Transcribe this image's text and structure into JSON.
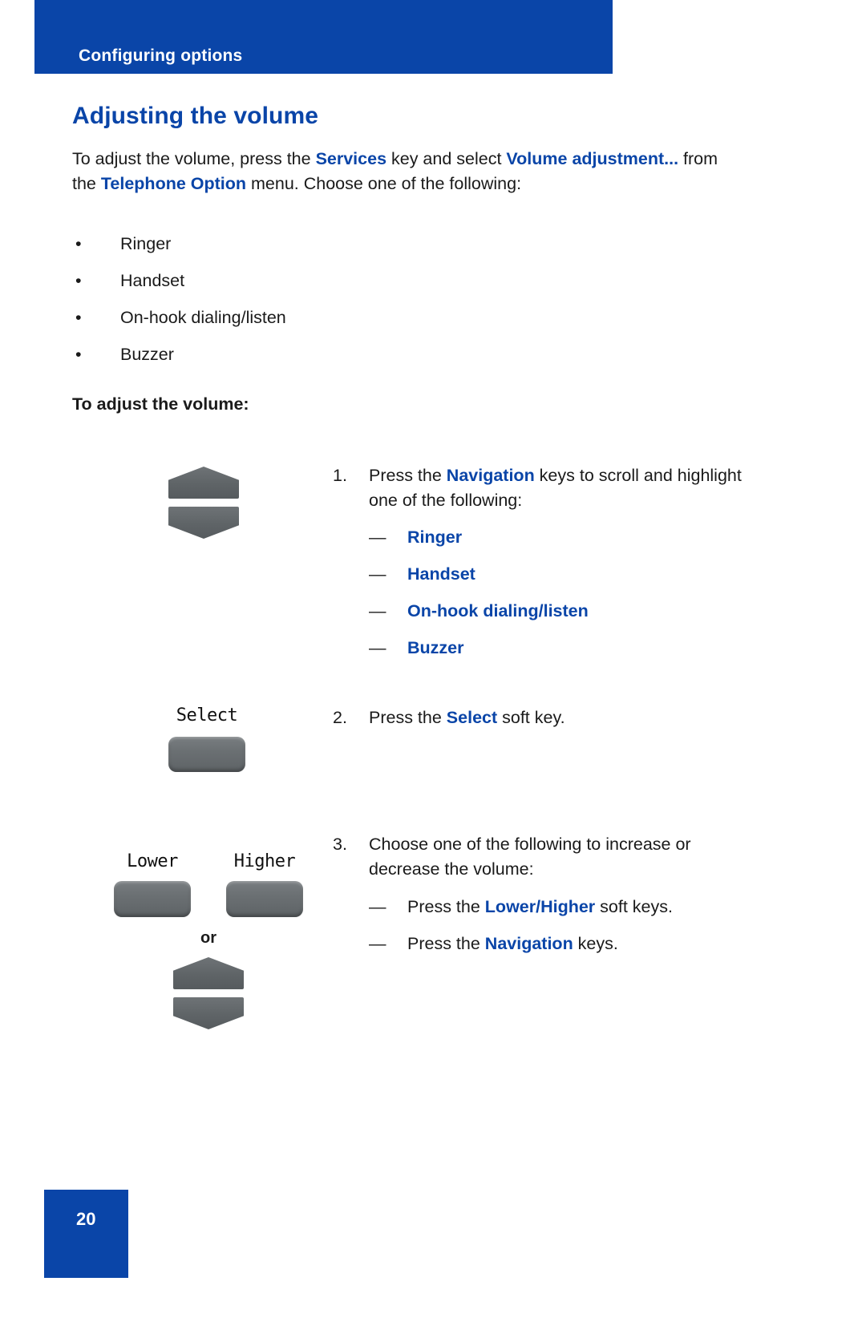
{
  "header": {
    "breadcrumb": "Configuring options"
  },
  "page_title": "Adjusting the volume",
  "intro": {
    "p1": "To adjust the volume, press the ",
    "services": "Services",
    "p2": " key and select ",
    "volume_adjustment": "Volume adjustment...",
    "p3": " from the ",
    "telephone_option": "Telephone Option",
    "p4": " menu. Choose one of the following:"
  },
  "bullet_marker": "•",
  "options": [
    "Ringer",
    "Handset",
    "On-hook dialing/listen",
    "Buzzer"
  ],
  "sub_heading": "To adjust the volume:",
  "dash_marker": "—",
  "steps": [
    {
      "number": "1.",
      "text_before": "Press the ",
      "link": "Navigation",
      "text_after": " keys to scroll and highlight one of the following:",
      "sub_items": [
        "Ringer",
        "Handset",
        "On-hook dialing/listen",
        "Buzzer"
      ],
      "art": {
        "type": "navigation-keys",
        "up_key_name": "navigation-key-up",
        "down_key_name": "navigation-key-down"
      }
    },
    {
      "number": "2.",
      "text_before": "Press the ",
      "link": "Select",
      "text_after": " soft key.",
      "sub_items": [],
      "art": {
        "type": "soft-key",
        "label": "Select"
      }
    },
    {
      "number": "3.",
      "text_before": "Choose one of the following to increase or decrease the volume:",
      "link": "",
      "text_after": "",
      "sub_items": [],
      "art": {
        "type": "volume-keys",
        "lower_label": "Lower",
        "higher_label": "Higher",
        "or_label": "or"
      }
    }
  ],
  "step3_bullets": [
    {
      "before": "Press the ",
      "link": "Lower/Higher",
      "after": " soft keys."
    },
    {
      "before": "Press the ",
      "link": "Navigation",
      "after": " keys."
    }
  ],
  "footer": {
    "page_number": "20"
  },
  "colors": {
    "brand_blue": "#0a45a8",
    "text": "#1a1a1a",
    "key_gray": "#63686b"
  }
}
